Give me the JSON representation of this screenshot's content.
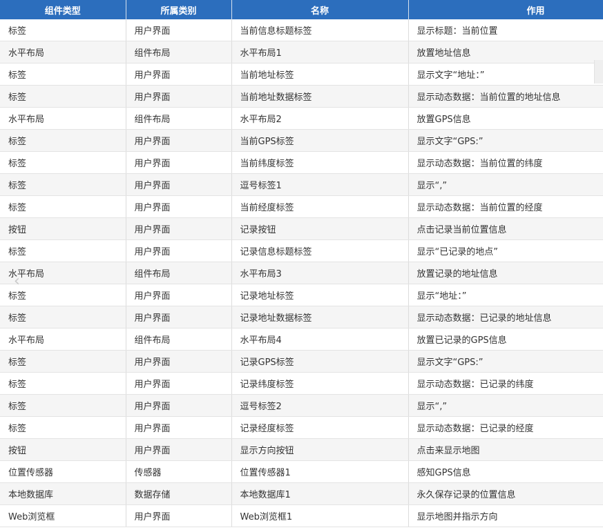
{
  "table": {
    "headers": [
      "组件类型",
      "所属类别",
      "名称",
      "作用"
    ],
    "rows": [
      [
        "标签",
        "用户界面",
        "当前信息标题标签",
        "显示标题：当前位置"
      ],
      [
        "水平布局",
        "组件布局",
        "水平布局1",
        "放置地址信息"
      ],
      [
        "标签",
        "用户界面",
        "当前地址标签",
        "显示文字“地址：”"
      ],
      [
        "标签",
        "用户界面",
        "当前地址数据标签",
        "显示动态数据：当前位置的地址信息"
      ],
      [
        "水平布局",
        "组件布局",
        "水平布局2",
        "放置GPS信息"
      ],
      [
        "标签",
        "用户界面",
        "当前GPS标签",
        "显示文字“GPS:”"
      ],
      [
        "标签",
        "用户界面",
        "当前纬度标签",
        "显示动态数据：当前位置的纬度"
      ],
      [
        "标签",
        "用户界面",
        "逗号标签1",
        "显示“,”"
      ],
      [
        "标签",
        "用户界面",
        "当前经度标签",
        "显示动态数据：当前位置的经度"
      ],
      [
        "按钮",
        "用户界面",
        "记录按钮",
        "点击记录当前位置信息"
      ],
      [
        "标签",
        "用户界面",
        "记录信息标题标签",
        "显示“已记录的地点”"
      ],
      [
        "水平布局",
        "组件布局",
        "水平布局3",
        "放置记录的地址信息"
      ],
      [
        "标签",
        "用户界面",
        "记录地址标签",
        "显示“地址：”"
      ],
      [
        "标签",
        "用户界面",
        "记录地址数据标签",
        "显示动态数据：已记录的地址信息"
      ],
      [
        "水平布局",
        "组件布局",
        "水平布局4",
        "放置已记录的GPS信息"
      ],
      [
        "标签",
        "用户界面",
        "记录GPS标签",
        "显示文字“GPS:”"
      ],
      [
        "标签",
        "用户界面",
        "记录纬度标签",
        "显示动态数据：已记录的纬度"
      ],
      [
        "标签",
        "用户界面",
        "逗号标签2",
        "显示“,”"
      ],
      [
        "标签",
        "用户界面",
        "记录经度标签",
        "显示动态数据：已记录的经度"
      ],
      [
        "按钮",
        "用户界面",
        "显示方向按钮",
        "点击来显示地图"
      ],
      [
        "位置传感器",
        "传感器",
        "位置传感器1",
        "感知GPS信息"
      ],
      [
        "本地数据库",
        "数据存储",
        "本地数据库1",
        "永久保存记录的位置信息"
      ],
      [
        "Web浏览框",
        "用户界面",
        "Web浏览框1",
        "显示地图并指示方向"
      ]
    ]
  },
  "controls": {
    "prev_icon": "chevron-left-icon",
    "prev_glyph": "‹"
  },
  "colors": {
    "header_bg": "#2c6ebd",
    "header_text": "#ffffff",
    "row_alt_bg": "#f5f5f5"
  }
}
